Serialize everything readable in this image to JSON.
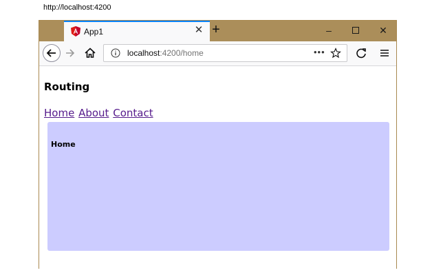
{
  "caption": "http://localhost:4200",
  "browser": {
    "tab_title": "App1",
    "tab_icon": "angular-logo-icon",
    "url_host": "localhost",
    "url_rest": ":4200/home"
  },
  "page": {
    "heading": "Routing",
    "nav": [
      {
        "label": "Home"
      },
      {
        "label": "About"
      },
      {
        "label": "Contact"
      }
    ],
    "panel_heading": "Home",
    "panel_color": "#ccccff"
  },
  "colors": {
    "titlebar": "#ab8e5a",
    "tab_accent": "#0a84ff",
    "link": "#551a8b"
  }
}
